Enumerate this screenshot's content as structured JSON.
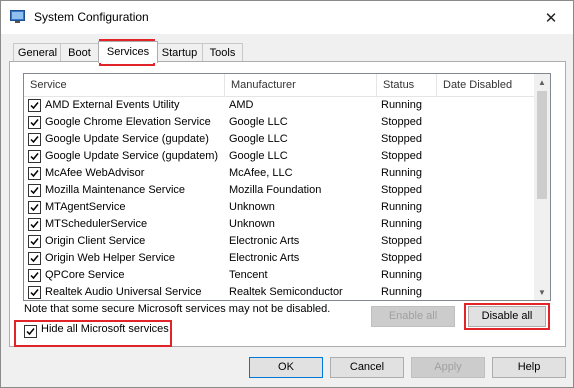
{
  "window": {
    "title": "System Configuration",
    "close_glyph": "✕"
  },
  "tabs": [
    {
      "label": "General"
    },
    {
      "label": "Boot"
    },
    {
      "label": "Services",
      "active": true
    },
    {
      "label": "Startup"
    },
    {
      "label": "Tools"
    }
  ],
  "list": {
    "columns": [
      "Service",
      "Manufacturer",
      "Status",
      "Date Disabled"
    ],
    "rows": [
      {
        "service": "AMD External Events Utility",
        "manufacturer": "AMD",
        "status": "Running",
        "checked": true
      },
      {
        "service": "Google Chrome Elevation Service",
        "manufacturer": "Google LLC",
        "status": "Stopped",
        "checked": true
      },
      {
        "service": "Google Update Service (gupdate)",
        "manufacturer": "Google LLC",
        "status": "Stopped",
        "checked": true
      },
      {
        "service": "Google Update Service (gupdatem)",
        "manufacturer": "Google LLC",
        "status": "Stopped",
        "checked": true
      },
      {
        "service": "McAfee WebAdvisor",
        "manufacturer": "McAfee, LLC",
        "status": "Running",
        "checked": true
      },
      {
        "service": "Mozilla Maintenance Service",
        "manufacturer": "Mozilla Foundation",
        "status": "Stopped",
        "checked": true
      },
      {
        "service": "MTAgentService",
        "manufacturer": "Unknown",
        "status": "Running",
        "checked": true
      },
      {
        "service": "MTSchedulerService",
        "manufacturer": "Unknown",
        "status": "Running",
        "checked": true
      },
      {
        "service": "Origin Client Service",
        "manufacturer": "Electronic Arts",
        "status": "Stopped",
        "checked": true
      },
      {
        "service": "Origin Web Helper Service",
        "manufacturer": "Electronic Arts",
        "status": "Stopped",
        "checked": true
      },
      {
        "service": "QPCore Service",
        "manufacturer": "Tencent",
        "status": "Running",
        "checked": true
      },
      {
        "service": "Realtek Audio Universal Service",
        "manufacturer": "Realtek Semiconductor",
        "status": "Running",
        "checked": true
      }
    ]
  },
  "note": "Note that some secure Microsoft services may not be disabled.",
  "buttons": {
    "enable_all": "Enable all",
    "disable_all": "Disable all",
    "ok": "OK",
    "cancel": "Cancel",
    "apply": "Apply",
    "help": "Help"
  },
  "hide_ms": {
    "label": "Hide all Microsoft services",
    "checked": true
  },
  "colors": {
    "highlight": "#e0242a",
    "accent": "#0078d7"
  },
  "icons": [
    "system-config-icon",
    "close-icon",
    "checkbox-check-icon",
    "scroll-up-icon",
    "scroll-down-icon"
  ]
}
